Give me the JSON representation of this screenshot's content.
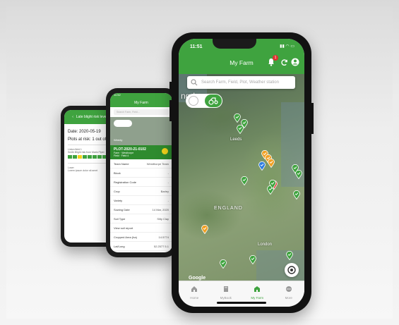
{
  "phone1": {
    "header_title": "Late blight risk level",
    "date": "Date: 2020-05-19",
    "plots_at_risk": "Plots at risk: 1 out of 4",
    "entries": [
      {
        "label": "Linton field 1",
        "sub": "Smith Blight risk from Maris Piper"
      },
      {
        "label": "Loser",
        "sub": "Lorem ipsum dolor sit amet"
      }
    ],
    "risk_colors": [
      "#3fa33f",
      "#3fa33f",
      "#f3d21b",
      "#3fa33f",
      "#3fa33f",
      "#3fa33f",
      "#3fa33f",
      "#3fa33f"
    ]
  },
  "phone2": {
    "status_time": "11:52",
    "title": "My Farm",
    "search_placeholder": "Search Farm, Field...",
    "section": "Weedy",
    "card": {
      "title": "PLOT-2020-21-0102",
      "sub1": "Farm · Westhorpe",
      "sub2": "Field · Field 4",
      "dot_label": "25"
    },
    "rows": [
      {
        "label": "Team Name",
        "value": "Westthorpe Team"
      },
      {
        "label": "Block",
        "value": "-"
      },
      {
        "label": "Registration Code",
        "value": "-"
      },
      {
        "label": "Crop",
        "value": "Barley"
      },
      {
        "label": "Variety",
        "value": "-"
      },
      {
        "label": "Sowing Date",
        "value": "14 Mar, 2020"
      },
      {
        "label": "Soil Type",
        "value": "Silty Clay"
      },
      {
        "label": "View soil report",
        "value": ""
      },
      {
        "label": "Cropped Area (ha)",
        "value": "14.5774"
      },
      {
        "label": "Lat/Long",
        "value": "52.2577 5.1"
      },
      {
        "label": "Acres",
        "value": ""
      }
    ]
  },
  "phone3": {
    "status_time": "11:51",
    "title": "My Farm",
    "notification_count": "1",
    "search_placeholder": "Search Farm, Field, Plot, Weather station",
    "map_labels": [
      {
        "text": "Leeds",
        "name": "label-leeds"
      },
      {
        "text": "ENGLAND",
        "name": "label-england"
      },
      {
        "text": "London",
        "name": "label-london"
      },
      {
        "text": "ngdom",
        "name": "label-kingdom"
      }
    ],
    "google_logo": "Google",
    "tabs": [
      {
        "label": "Home",
        "icon": "home-icon"
      },
      {
        "label": "MyBook",
        "icon": "book-icon"
      },
      {
        "label": "My Farm",
        "icon": "farm-icon"
      },
      {
        "label": "More",
        "icon": "more-icon"
      }
    ],
    "active_tab": "My Farm",
    "colors": {
      "brand_green": "#3fa33f",
      "warning_orange": "#f0a023",
      "alert_red": "#e03030",
      "info_blue": "#2f7de1"
    }
  }
}
